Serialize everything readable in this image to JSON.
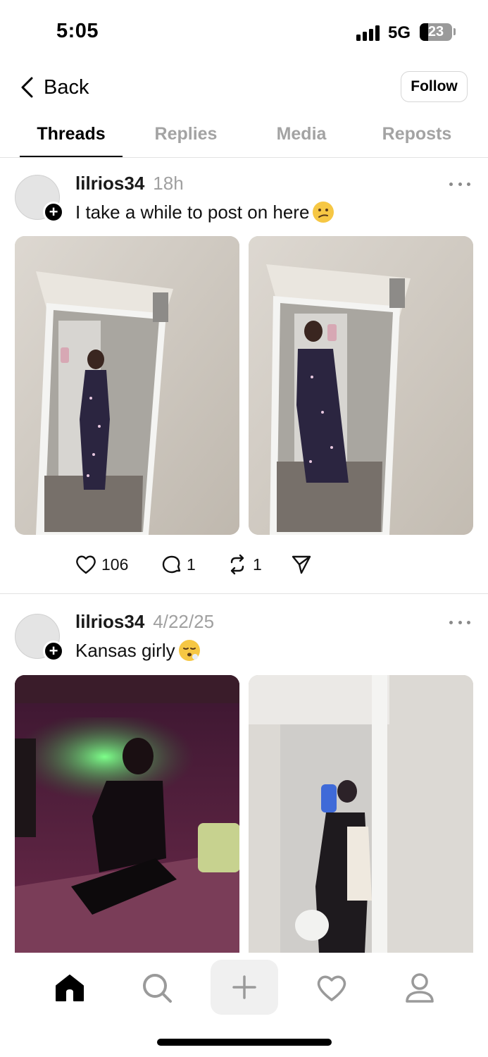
{
  "status_bar": {
    "time": "5:05",
    "network": "5G",
    "battery": "23"
  },
  "header": {
    "back_label": "Back",
    "follow_label": "Follow"
  },
  "tabs": [
    {
      "label": "Threads",
      "active": true
    },
    {
      "label": "Replies",
      "active": false
    },
    {
      "label": "Media",
      "active": false
    },
    {
      "label": "Reposts",
      "active": false
    }
  ],
  "posts": [
    {
      "username": "lilrios34",
      "time": "18h",
      "text": "I take a while to post on here",
      "emoji": "confused-face",
      "images": [
        "mirror-selfie-photo",
        "mirror-selfie-photo"
      ],
      "likes": "106",
      "replies": "1",
      "reposts": "1"
    },
    {
      "username": "lilrios34",
      "time": "4/22/25",
      "text": "Kansas girly",
      "emoji": "exhaling-face",
      "images": [
        "neon-bar-photo",
        "bathroom-selfie-photo"
      ]
    }
  ],
  "colors": {
    "muted_text": "#a0a0a0",
    "divider": "#e2e2e2",
    "plus_bg": "#f0f0f0",
    "avatar": "#e4e4e4"
  }
}
